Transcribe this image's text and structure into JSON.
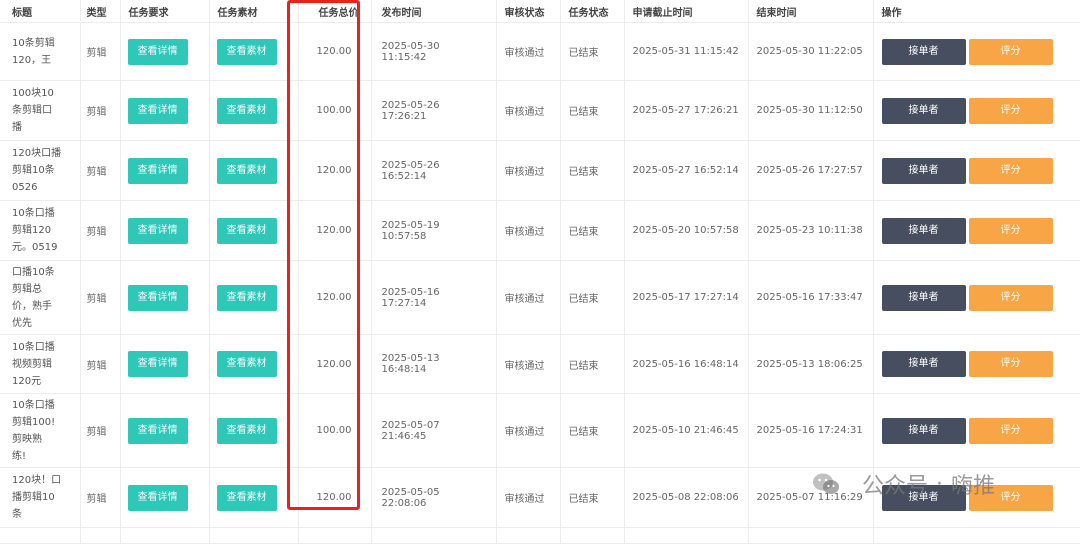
{
  "headers": {
    "title": "标题",
    "type": "类型",
    "requirement": "任务要求",
    "material": "任务素材",
    "total": "任务总价",
    "publish_time": "发布时间",
    "review_status": "审核状态",
    "task_status": "任务状态",
    "apply_deadline": "申请截止时间",
    "end_time": "结束时间",
    "actions": "操作"
  },
  "buttons": {
    "details": "查看详情",
    "material": "查看素材",
    "taker": "接单者",
    "rate": "评分"
  },
  "rows": [
    {
      "title": "10条剪辑\n120，王",
      "type": "剪辑",
      "total": "120.00",
      "publish": "2025-05-30 11:15:42",
      "review": "审核通过",
      "status": "已结束",
      "deadline": "2025-05-31 11:15:42",
      "end": "2025-05-30 11:22:05"
    },
    {
      "title": "100块10\n条剪辑口\n播",
      "type": "剪辑",
      "total": "100.00",
      "publish": "2025-05-26 17:26:21",
      "review": "审核通过",
      "status": "已结束",
      "deadline": "2025-05-27 17:26:21",
      "end": "2025-05-30 11:12:50"
    },
    {
      "title": "120块口播\n剪辑10条\n0526",
      "type": "剪辑",
      "total": "120.00",
      "publish": "2025-05-26 16:52:14",
      "review": "审核通过",
      "status": "已结束",
      "deadline": "2025-05-27 16:52:14",
      "end": "2025-05-26 17:27:57"
    },
    {
      "title": "10条口播\n剪辑120\n元。0519",
      "type": "剪辑",
      "total": "120.00",
      "publish": "2025-05-19 10:57:58",
      "review": "审核通过",
      "status": "已结束",
      "deadline": "2025-05-20 10:57:58",
      "end": "2025-05-23 10:11:38"
    },
    {
      "title": "口播10条\n剪辑总\n价，熟手\n优先",
      "type": "剪辑",
      "total": "120.00",
      "publish": "2025-05-16 17:27:14",
      "review": "审核通过",
      "status": "已结束",
      "deadline": "2025-05-17 17:27:14",
      "end": "2025-05-16 17:33:47"
    },
    {
      "title": "10条口播\n视频剪辑\n120元",
      "type": "剪辑",
      "total": "120.00",
      "publish": "2025-05-13 16:48:14",
      "review": "审核通过",
      "status": "已结束",
      "deadline": "2025-05-16 16:48:14",
      "end": "2025-05-13 18:06:25"
    },
    {
      "title": "10条口播\n剪辑100!\n剪映熟\n练!",
      "type": "剪辑",
      "total": "100.00",
      "publish": "2025-05-07 21:46:45",
      "review": "审核通过",
      "status": "已结束",
      "deadline": "2025-05-10 21:46:45",
      "end": "2025-05-16 17:24:31"
    },
    {
      "title": "120块！口\n播剪辑10\n条",
      "type": "剪辑",
      "total": "120.00",
      "publish": "2025-05-05 22:08:06",
      "review": "审核通过",
      "status": "已结束",
      "deadline": "2025-05-08 22:08:06",
      "end": "2025-05-07 11:16:29"
    }
  ],
  "watermark": {
    "part1": "公众号",
    "sep": "·",
    "part2": "嗨推"
  },
  "colors": {
    "teal": "#2ec7b8",
    "dark": "#464e5f",
    "orange": "#f8a546",
    "highlight": "#e8231f"
  }
}
